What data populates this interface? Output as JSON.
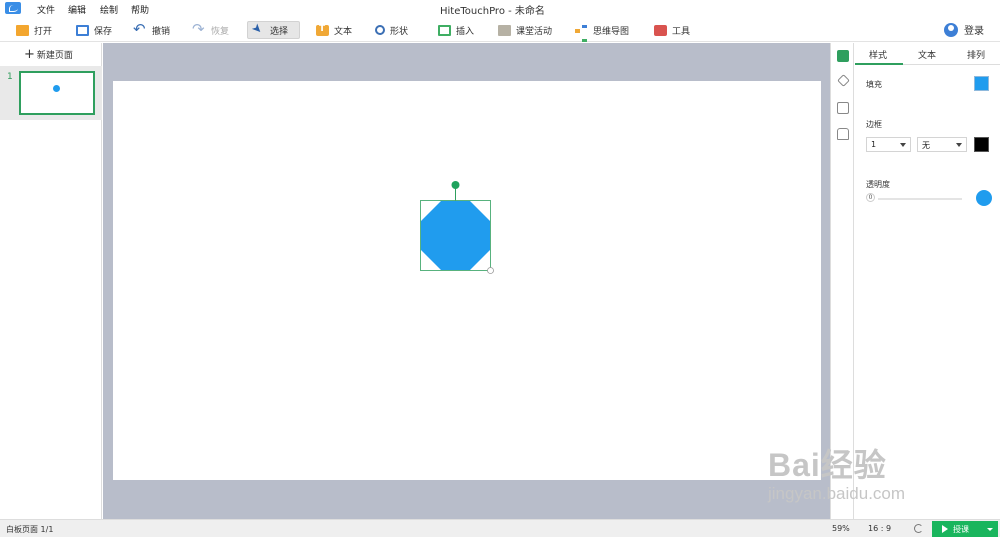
{
  "app": {
    "title": "HiteTouchPro - 未命名"
  },
  "menu": {
    "items": [
      "文件",
      "编辑",
      "绘制",
      "帮助"
    ]
  },
  "toolbar": {
    "open": "打开",
    "save": "保存",
    "undo": "撤销",
    "redo": "恢复",
    "select": "选择",
    "text": "文本",
    "shape": "形状",
    "insert": "插入",
    "classroom": "课堂活动",
    "mindmap": "思维导图",
    "tools": "工具",
    "login": "登录"
  },
  "pages": {
    "new_page": "新建页面",
    "items": [
      {
        "number": "1"
      }
    ]
  },
  "canvas": {
    "shape": {
      "type": "octagon",
      "fill": "#209cee",
      "selected": true
    }
  },
  "properties": {
    "tabs": [
      "样式",
      "文本",
      "排列"
    ],
    "fill_label": "填充",
    "fill_color": "#209cee",
    "border_label": "边框",
    "border_width": "1",
    "border_style": "无",
    "border_color": "#000000",
    "opacity_label": "透明度",
    "opacity_min": "0"
  },
  "status": {
    "page_info": "白板页面 1/1",
    "zoom": "59%",
    "ratio": "16 : 9",
    "teach": "授课"
  },
  "watermark": {
    "brand": "Bai经验",
    "url": "jingyan.baidu.com"
  },
  "colors": {
    "accent": "#2f9f5e",
    "shape_blue": "#209cee",
    "canvas_bg": "#b8bdca",
    "teach_green": "#19b55d"
  }
}
